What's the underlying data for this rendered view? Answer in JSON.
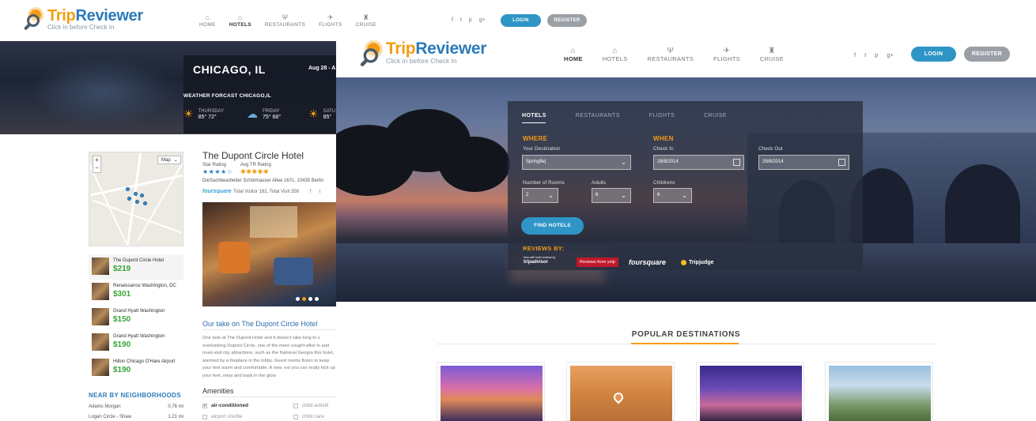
{
  "back_page": {
    "logo": {
      "name_main": "Trip",
      "name_accent": "Reviewer",
      "tagline": "Click in before Check In"
    },
    "nav": [
      {
        "label": "HOME",
        "icon": "home-icon",
        "glyph": "⌂"
      },
      {
        "label": "HOTELS",
        "icon": "hotel-icon",
        "glyph": "⌂"
      },
      {
        "label": "RESTAURANTS",
        "icon": "fork-knife-icon",
        "glyph": "Ψ"
      },
      {
        "label": "FLIGHTS",
        "icon": "plane-icon",
        "glyph": "✈"
      },
      {
        "label": "CRUISE",
        "icon": "ship-icon",
        "glyph": "♜"
      }
    ],
    "active_nav": "HOTELS",
    "social": [
      "f",
      "t",
      "p",
      "g+"
    ],
    "login_label": "LOGIN",
    "register_label": "REGISTER",
    "city": "CHICAGO, IL",
    "date_range": "Aug 28 - A",
    "weather_title": "WEATHER FORCAST CHICAGO,IL",
    "weather": [
      {
        "day": "THURSDAY",
        "temp": "85° 72°",
        "icon": "sun-icon"
      },
      {
        "day": "FRIDAY",
        "temp": "75° 68°",
        "icon": "cloud-icon"
      },
      {
        "day": "SATU",
        "temp": "85°",
        "icon": "sun-icon"
      }
    ],
    "map_type": "Map",
    "map_zoom_in": "+",
    "map_zoom_out": "−",
    "hotels": [
      {
        "name": "The Dupont Circle Hotel",
        "price": "$219",
        "selected": true
      },
      {
        "name": "Renaissance Washington, DC",
        "price": "$301",
        "selected": false
      },
      {
        "name": "Grand Hyatt Washington",
        "price": "$150",
        "selected": false
      },
      {
        "name": "Grand Hyatt Washington",
        "price": "$190",
        "selected": false
      },
      {
        "name": "Hilton Chicago O'Hare Airport",
        "price": "$190",
        "selected": false
      }
    ],
    "neighborhoods_title": "NEAR BY NEIGHBORHOODS",
    "neighborhoods": [
      {
        "name": "Adams Morgan",
        "dist": "0.76 mi"
      },
      {
        "name": "Logan Circle - Shaw",
        "dist": "1.21 mi"
      }
    ],
    "hotel_title": "The Dupont Circle Hotel",
    "star_rating_label": "Star Rating",
    "star_rating": "★★★★☆",
    "tr_rating_label": "Avg TR Rating",
    "tr_rating": "✺✺✺✺✺",
    "address": "DieSachbearbeiter Schönhauser Allee 167c, 10435 Berlin",
    "foursquare": "foursquare",
    "visits": "Total Visitor 182, Total Visit 356",
    "photo_slide": 2,
    "photo_slides_total": 4,
    "our_take_title": "Our take on The Dupont Circle Hotel",
    "our_take_text": "One look at The Dupont Hotel and it doesn't take long to s overlooking Dupont Circle, one of the more sought-after lo and must-visit city attractions, such as the National Geogra this hotel, warmed by a fireplace in the lobby. Guest rooms floors to keep your feet warm and comfortable. A new, ext you can really kick up your feet, relax and bask in the glow",
    "amenities_title": "Amenities",
    "amenities": [
      {
        "label": "air-conditioned",
        "checked": true
      },
      {
        "label": "child activiti",
        "checked": false
      },
      {
        "label": "airport shuttle",
        "checked": false
      },
      {
        "label": "child care",
        "checked": false
      }
    ]
  },
  "front_page": {
    "logo": {
      "name_main": "Trip",
      "name_accent": "Reviewer",
      "tagline": "Click in before Check In"
    },
    "nav": [
      {
        "label": "HOME",
        "icon": "home-icon",
        "glyph": "⌂"
      },
      {
        "label": "HOTELS",
        "icon": "hotel-icon",
        "glyph": "⌂"
      },
      {
        "label": "RESTAURANTS",
        "icon": "fork-knife-icon",
        "glyph": "Ψ"
      },
      {
        "label": "FLIGHTS",
        "icon": "plane-icon",
        "glyph": "✈"
      },
      {
        "label": "CRUISE",
        "icon": "ship-icon",
        "glyph": "♜"
      }
    ],
    "active_nav": "HOME",
    "social": [
      "f",
      "t",
      "p",
      "g+"
    ],
    "login_label": "LOGIN",
    "register_label": "REGISTER",
    "search_tabs": [
      "HOTELS",
      "RESTAURANTS",
      "FLIGHTS",
      "CRUISE"
    ],
    "active_tab": "HOTELS",
    "where_title": "WHERE",
    "when_title": "WHEN",
    "destination_label": "Your Destination",
    "destination_value": "Springfie|",
    "checkin_label": "Check In",
    "checkin_value": "28/8/2014",
    "checkout_label": "Check Out",
    "checkout_value": "29/8/2014",
    "rooms_label": "Number of Rooms",
    "rooms_value": "2",
    "adults_label": "Adults",
    "adults_value": "6",
    "children_label": "Childrens",
    "children_value": "6",
    "find_label": "FIND HOTELS",
    "reviews_by": "REVIEWS BY:",
    "review_sources": [
      "tripadvisor",
      "Reviews from yelp",
      "foursquare",
      "Tripjudge"
    ],
    "tripadvisor_small": "Now with hotel reviews by",
    "popular_title": "POPULAR DESTINATIONS"
  },
  "colors": {
    "brand_blue": "#2b7bb9",
    "brand_orange": "#f39c12",
    "login_blue": "#2e95c6",
    "register_gray": "#9aa0a6",
    "price_green": "#3aa335"
  }
}
